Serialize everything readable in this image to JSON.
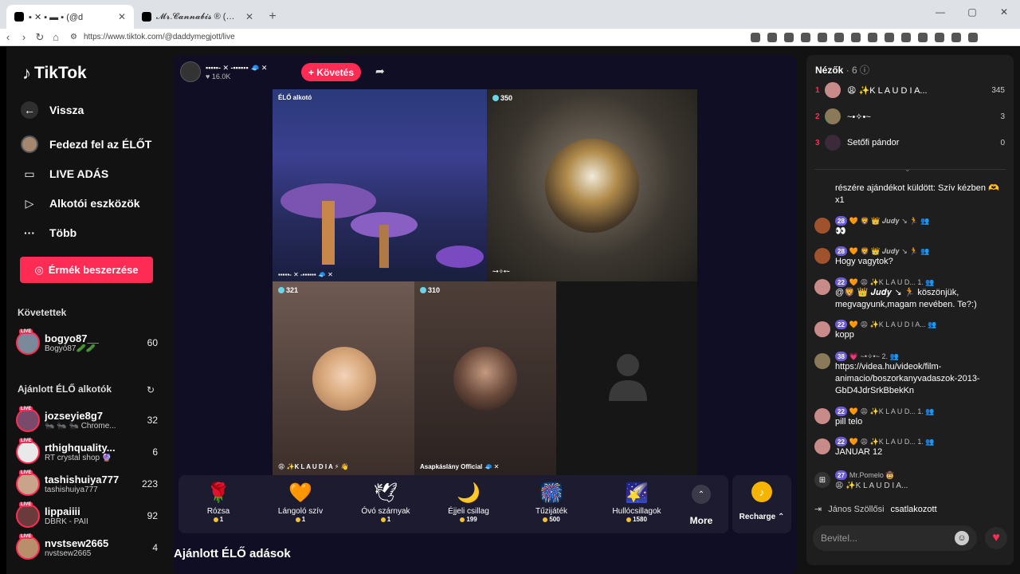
{
  "browser": {
    "tabs": [
      {
        "title": "▪ ✕ ▪ ▬ ▪ (@d"
      },
      {
        "title": "𝓜𝓻.𝓒𝓪𝓷𝓷𝓪𝓫𝓲𝓼 ® (@mrcannabis_)"
      }
    ],
    "url": "https://www.tiktok.com/@daddymegjott/live"
  },
  "sidebar": {
    "logo": "TikTok",
    "nav": [
      {
        "label": "Vissza",
        "icon": "arrow-left-icon"
      },
      {
        "label": "Fedezd fel az ÉLŐT",
        "icon": "avatar"
      },
      {
        "label": "LIVE ADÁS",
        "icon": "video-camera-icon"
      },
      {
        "label": "Alkotói eszközök",
        "icon": "play-square-icon"
      },
      {
        "label": "Több",
        "icon": "more-icon"
      }
    ],
    "coins_button": "Érmék beszerzése",
    "following_title": "Követettek",
    "following": [
      {
        "name": "bogyo87__",
        "sub": "Bogyó87🥒🥒",
        "count": "60"
      }
    ],
    "recommended_title": "Ajánlott ÉLŐ alkotók",
    "recommended": [
      {
        "name": "jozseyie8g7",
        "sub": "🐜 🐜 🐜 Chrome...",
        "count": "32",
        "color": "#7a4a6a"
      },
      {
        "name": "rthighquality...",
        "sub": "RT crystal shop 🔮",
        "count": "6",
        "color": "#e9e9e9"
      },
      {
        "name": "tashishuiya777",
        "sub": "tashishuiya777",
        "count": "223",
        "color": "#caa38b"
      },
      {
        "name": "lippaiiii",
        "sub": "DBRK - PAII",
        "count": "92",
        "color": "#6b3b3b"
      },
      {
        "name": "nvstsew2665",
        "sub": "nvstsew2665",
        "count": "4",
        "color": "#b98e6a"
      }
    ],
    "live_badge": "LIVE"
  },
  "stream": {
    "host_name": "▪▪▪▪▪- ✕ -▪▪▪▪▪▪ 🧢 ✕",
    "host_likes": "16.0K",
    "follow_label": "+ Követés",
    "tiles": [
      {
        "label": "ÉLŐ alkotó",
        "bottom_label": "▪▪▪▪▪- ✕ -▪▪▪▪▪▪ 🧢 ✕",
        "viewers": ""
      },
      {
        "label": "",
        "bottom_label": "~•✧•~",
        "viewers": "350"
      },
      {
        "label": "",
        "bottom_label": "😩 ✨K L A U D I A ⚡ 👋",
        "viewers": "321"
      },
      {
        "label": "",
        "bottom_label": "Asapkáslány Official 🧢 ✕",
        "viewers": "310"
      }
    ],
    "gifts": [
      {
        "name": "Rózsa",
        "price": "1",
        "icon": "🌹"
      },
      {
        "name": "Lángoló szív",
        "price": "1",
        "icon": "🧡"
      },
      {
        "name": "Óvó szárnyak",
        "price": "1",
        "icon": "🕊"
      },
      {
        "name": "Éjjeli csillag",
        "price": "199",
        "icon": "🌙"
      },
      {
        "name": "Tűzijáték",
        "price": "500",
        "icon": "🎆"
      },
      {
        "name": "Hullócsillagok",
        "price": "1580",
        "icon": "🌠"
      }
    ],
    "more_label": "More",
    "recharge_label": "Recharge ⌃",
    "suggested_title": "Ajánlott ÉLŐ adások"
  },
  "viewers_panel": {
    "title": "Nézők",
    "count": "· 6",
    "rows": [
      {
        "rank": "1",
        "name": "😩 ✨K L A U D I A...",
        "score": "345",
        "color": "#c98a8a"
      },
      {
        "rank": "2",
        "name": "~•✧•~",
        "score": "3",
        "color": "#8a7a5a"
      },
      {
        "rank": "3",
        "name": "Setőfi pándor",
        "score": "0",
        "color": "#3a2a3a"
      }
    ]
  },
  "chat": [
    {
      "name": "",
      "level": "",
      "text": "részére ajándékot küldött: Szív kézben 🫶 x1",
      "color": ""
    },
    {
      "name": "🧡 🦁 👑 𝑱𝒖𝒅𝒚 ↘ 🏃 👥",
      "level": "28",
      "text": "👀",
      "color": "#a0522d"
    },
    {
      "name": "🧡 🦁 👑 𝑱𝒖𝒅𝒚 ↘ 🏃 👥",
      "level": "28",
      "text": "Hogy vagytok?",
      "color": "#a0522d"
    },
    {
      "name": "🧡 😩 ✨K L A U D... 1. 👥",
      "level": "22",
      "text": "@🦁 👑 𝑱𝒖𝒅𝒚 ↘ 🏃 köszönjük, megvagyunk,magam nevében. Te?:)",
      "color": "#c98a8a"
    },
    {
      "name": "🧡 😩 ✨K L A U D I A... 👥",
      "level": "22",
      "text": "kopp",
      "color": "#c98a8a"
    },
    {
      "name": "💗 ~•✧•~ 2. 👥",
      "level": "38",
      "text": "https://videa.hu/videok/film-animacio/boszorkanyvadaszok-2013-GbD4JdrSrkBbekKn",
      "color": "#8a7a5a"
    },
    {
      "name": "🧡 😩 ✨K L A U D... 1. 👥",
      "level": "22",
      "text": "pill telo",
      "color": "#c98a8a"
    },
    {
      "name": "🧡 😩 ✨K L A U D... 1. 👥",
      "level": "22",
      "text": "JANUAR 12",
      "color": "#c98a8a"
    },
    {
      "name": "Mr.Pomelo 🤠",
      "level": "27",
      "text": "😩 ✨K L A U D I A...",
      "color": "#333"
    }
  ],
  "joined": {
    "who": "János Szöllősi",
    "action": "csatlakozott"
  },
  "input_placeholder": "Bevitel...",
  "colors": {
    "accent": "#fe2c55",
    "panel": "#1e1e1e",
    "stage": "#0f0e24"
  }
}
